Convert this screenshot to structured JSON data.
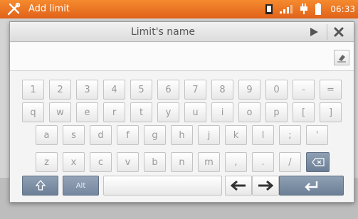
{
  "status_bar": {
    "title": "Add limit",
    "time": "06:33",
    "app_icon": "tools-icon",
    "icons": [
      "sd-card-icon",
      "signal-icon",
      "plug-icon",
      "battery-icon"
    ],
    "accent": "#ee7322"
  },
  "dialog": {
    "title": "Limit's name",
    "input_value": "",
    "next_icon": "play-icon",
    "close_icon": "close-icon",
    "eraser_icon": "eraser-icon"
  },
  "keyboard": {
    "row1": [
      "1",
      "2",
      "3",
      "4",
      "5",
      "6",
      "7",
      "8",
      "9",
      "0",
      "-",
      "="
    ],
    "row2": [
      "q",
      "w",
      "e",
      "r",
      "t",
      "y",
      "u",
      "i",
      "o",
      "p",
      "[",
      "]"
    ],
    "row3": [
      "a",
      "s",
      "d",
      "f",
      "g",
      "h",
      "j",
      "k",
      "l",
      ";",
      "'"
    ],
    "row4": [
      "z",
      "x",
      "c",
      "v",
      "b",
      "n",
      "m",
      ",",
      ".",
      "/"
    ],
    "shift_icon": "shift-icon",
    "backspace_icon": "backspace-icon",
    "alt_label": "Alt",
    "left_arrow_icon": "arrow-left-icon",
    "right_arrow_icon": "arrow-right-icon",
    "enter_icon": "enter-icon"
  }
}
